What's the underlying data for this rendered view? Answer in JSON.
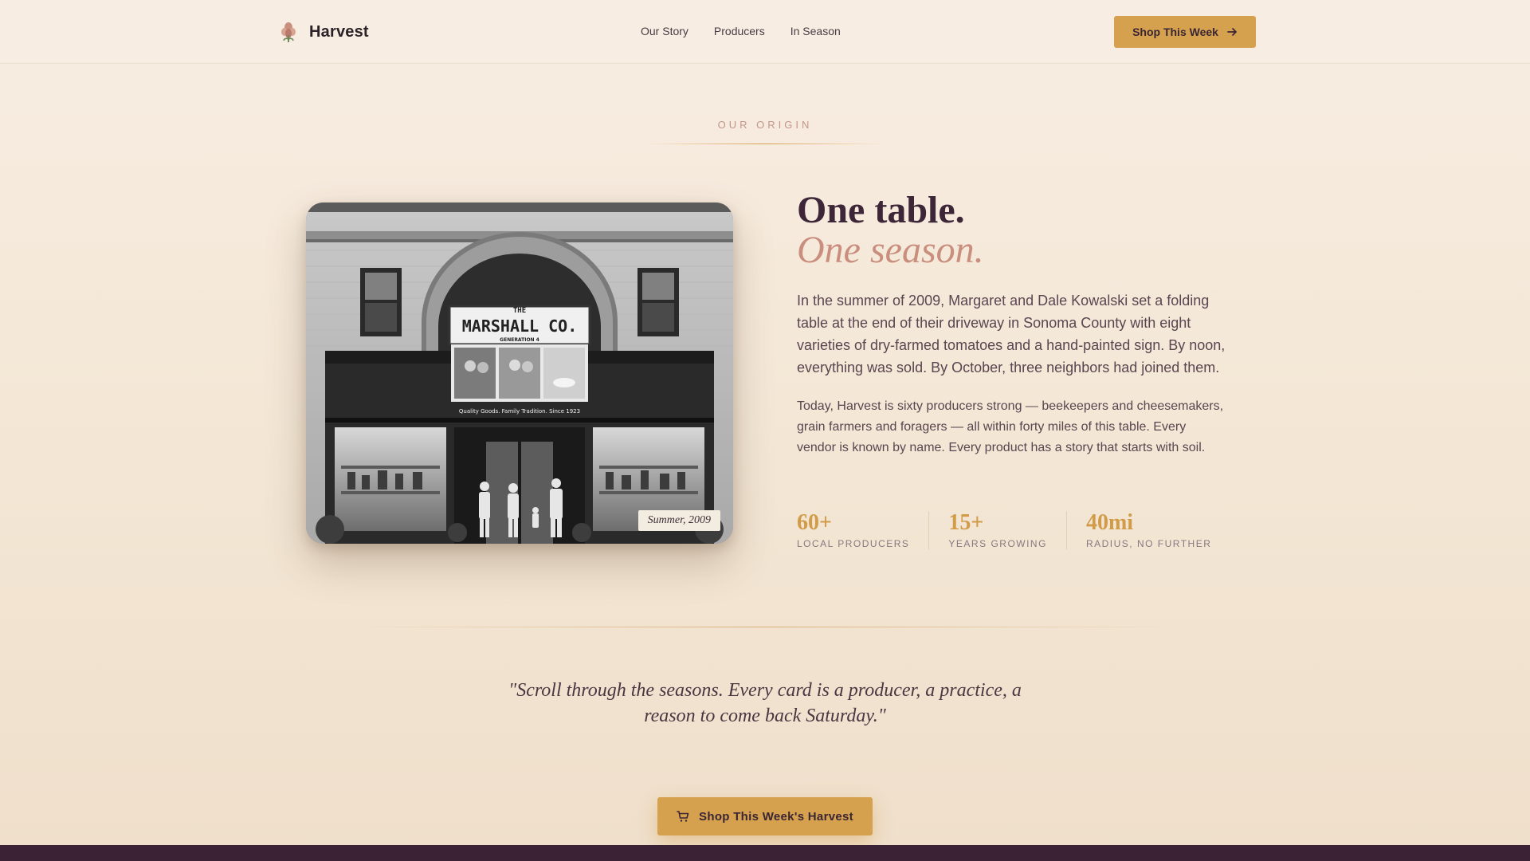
{
  "header": {
    "brand_name": "Harvest",
    "nav": [
      "Our Story",
      "Producers",
      "In Season"
    ],
    "cta_label": "Shop This Week"
  },
  "section": {
    "eyebrow": "Our Origin"
  },
  "photo": {
    "sign_line1": "THE",
    "sign_line2": "MARSHALL CO.",
    "sign_line3": "GENERATION 4",
    "tagline": "Quality Goods. Family Tradition. Since 1923",
    "caption": "Summer, 2009"
  },
  "story": {
    "headline": "One table.",
    "headline_accent": "One season.",
    "lead": "In the summer of 2009, Margaret and Dale Kowalski set a folding table at the end of their driveway in Sonoma County with eight varieties of dry-farmed tomatoes and a hand-painted sign. By noon, everything was sold. By October, three neighbors had joined them.",
    "body": "Today, Harvest is sixty producers strong — beekeepers and cheesemakers, grain farmers and foragers — all within forty miles of this table. Every vendor is known by name. Every product has a story that starts with soil."
  },
  "stats": [
    {
      "value": "60+",
      "label": "Local Producers"
    },
    {
      "value": "15+",
      "label": "Years Growing"
    },
    {
      "value": "40mi",
      "label": "Radius, No Further"
    }
  ],
  "quote": "\"Scroll through the seasons. Every card is a producer, a practice, a reason to come back Saturday.\"",
  "cta": {
    "label": "Shop This Week's Harvest"
  },
  "colors": {
    "accent": "#d6a14f",
    "heading": "#3d2638",
    "accent_italic": "#c98e7e",
    "footer": "#3b2335"
  },
  "icons": [
    "harvest-logo-icon",
    "arrow-right-icon",
    "cart-icon"
  ]
}
